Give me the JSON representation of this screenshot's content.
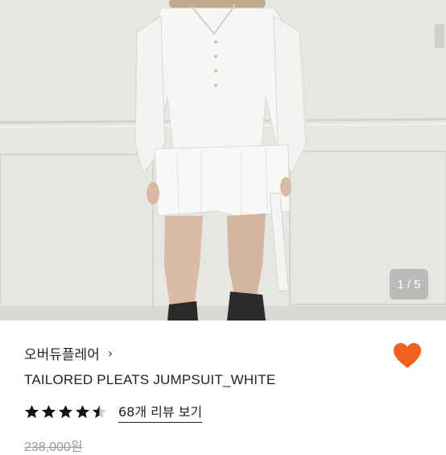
{
  "image": {
    "counter": "1 / 5"
  },
  "product": {
    "brand": "오버듀플레어",
    "brand_chevron": "›",
    "title": "TAILORED PLEATS JUMPSUIT_WHITE",
    "rating": 4.5,
    "review_link": "68개 리뷰 보기",
    "price": "238,000원",
    "liked": true
  },
  "colors": {
    "accent": "#f2601f",
    "star": "#111111",
    "text": "#222222"
  },
  "icons": {
    "heart": "heart-icon",
    "chevron": "chevron-right-icon",
    "star": "star-icon"
  }
}
